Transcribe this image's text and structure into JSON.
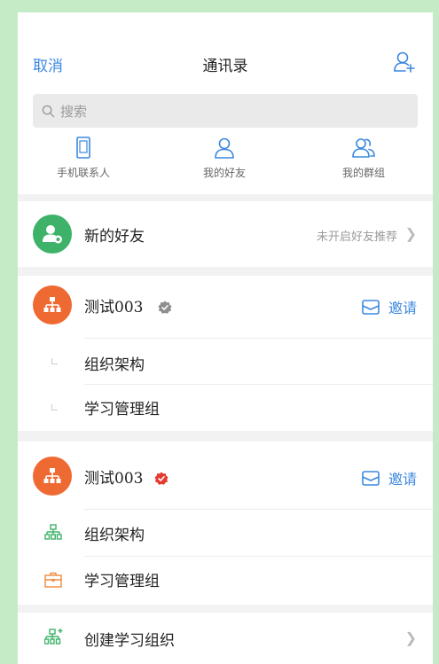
{
  "header": {
    "cancel_label": "取消",
    "title": "通讯录",
    "add_user_icon": "add-user-icon"
  },
  "search": {
    "placeholder": "搜索"
  },
  "quick_access": [
    {
      "label": "手机联系人",
      "icon": "phone-icon"
    },
    {
      "label": "我的好友",
      "icon": "person-icon"
    },
    {
      "label": "我的群组",
      "icon": "group-icon"
    }
  ],
  "new_friends": {
    "label": "新的好友",
    "hint": "未开启好友推荐",
    "avatar_color": "#3fb26a"
  },
  "orgs": [
    {
      "name": "测试003",
      "badge": "gray-verified-badge",
      "invite_label": "邀请",
      "items": [
        "组织架构",
        "学习管理组"
      ]
    },
    {
      "name": "测试003",
      "badge": "red-verified-badge",
      "invite_label": "邀请",
      "items": [
        "组织架构",
        "学习管理组"
      ]
    }
  ],
  "create_org": {
    "label": "创建学习组织"
  },
  "colors": {
    "accent": "#3c88e0",
    "org_avatar": "#ef6a32",
    "green": "#3fb26a",
    "orange": "#ef8a3c",
    "verified_red": "#e23b2f",
    "verified_gray": "#8e8e8e"
  }
}
